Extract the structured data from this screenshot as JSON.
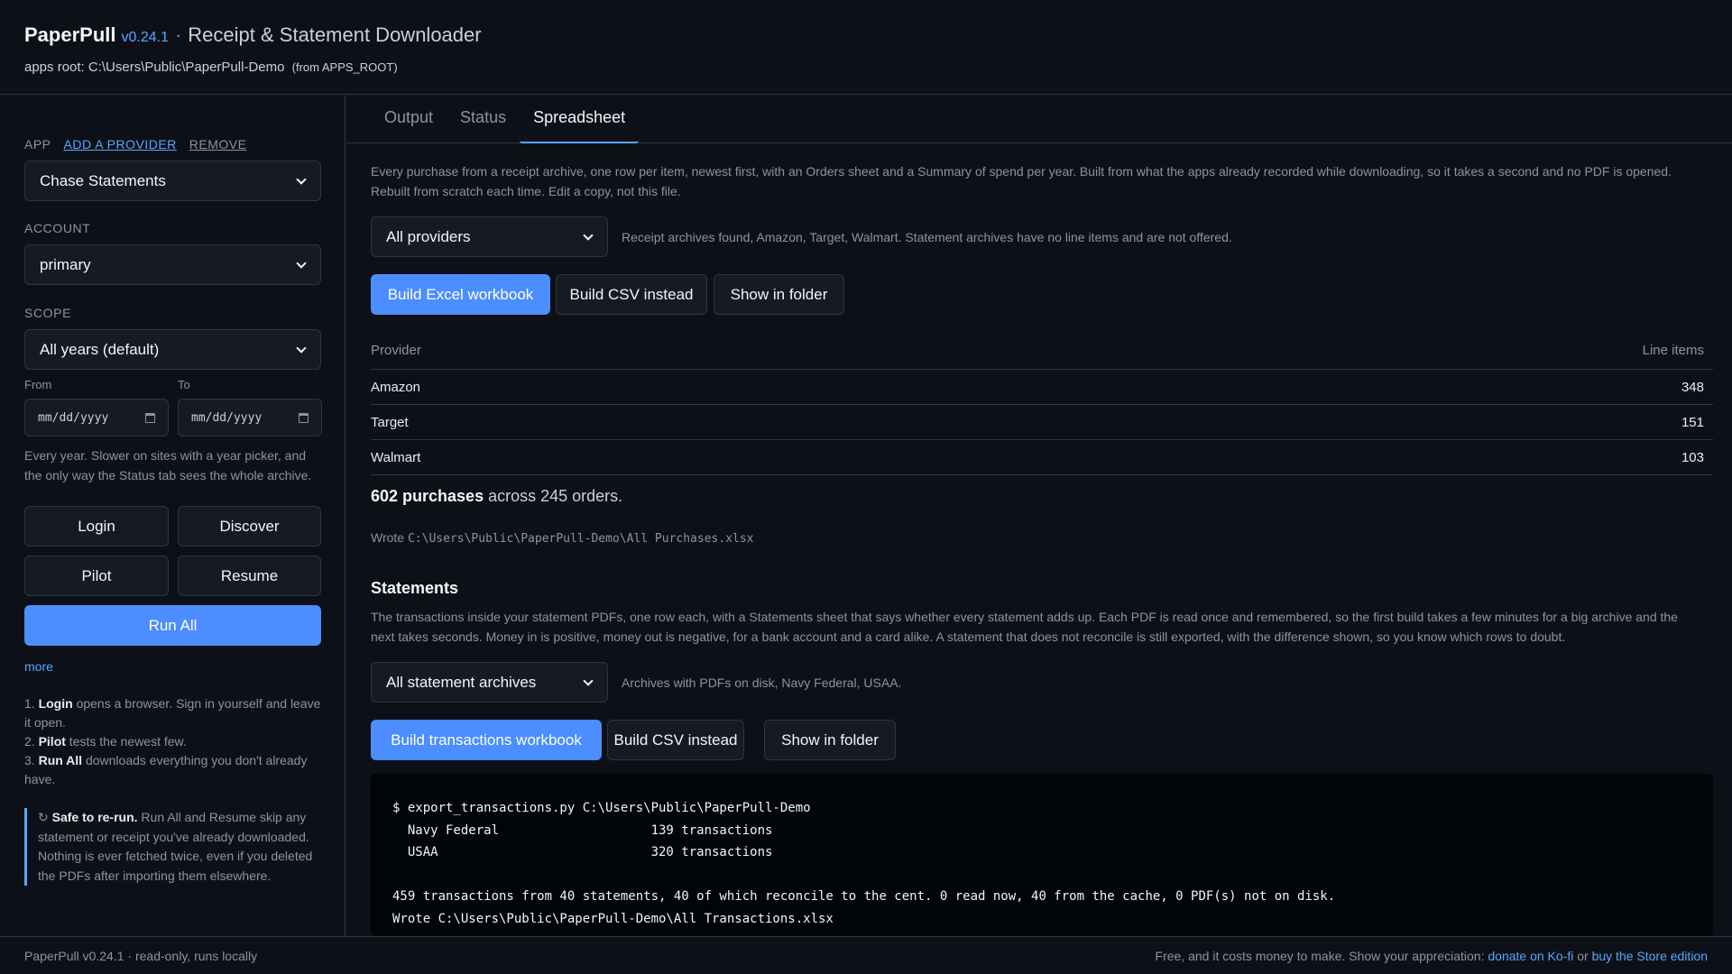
{
  "header": {
    "app_name": "PaperPull",
    "version": "v0.24.1",
    "separator": "·",
    "subtitle": "Receipt & Statement Downloader",
    "apps_root": "apps root: C:\\Users\\Public\\PaperPull-Demo",
    "apps_root_note": "(from APPS_ROOT)"
  },
  "sidebar": {
    "app_label": "APP",
    "add_provider": "ADD A PROVIDER",
    "remove": "REMOVE",
    "app_select": "Chase Statements",
    "account_label": "ACCOUNT",
    "account_select": "primary",
    "scope_label": "SCOPE",
    "scope_select": "All years (default)",
    "from_label": "From",
    "to_label": "To",
    "from_value": "mm/dd/yyyy",
    "to_value": "mm/dd/yyyy",
    "scope_hint": "Every year. Slower on sites with a year picker, and the only way the Status tab sees the whole archive.",
    "buttons": {
      "login": "Login",
      "discover": "Discover",
      "pilot": "Pilot",
      "resume": "Resume",
      "run_all": "Run All"
    },
    "more": "more",
    "steps": [
      {
        "num": "1.",
        "bold": "Login",
        "text": " opens a browser. Sign in yourself and leave it open."
      },
      {
        "num": "2.",
        "bold": "Pilot",
        "text": " tests the newest few."
      },
      {
        "num": "3.",
        "bold": "Run All",
        "text": " downloads everything you don't already have."
      }
    ],
    "safe": {
      "icon": "↻",
      "bold": "Safe to re-run.",
      "text": " Run All and Resume skip any statement or receipt you've already downloaded. Nothing is ever fetched twice, even if you deleted the PDFs after importing them elsewhere."
    }
  },
  "tabs": [
    {
      "label": "Output",
      "active": false
    },
    {
      "label": "Status",
      "active": false
    },
    {
      "label": "Spreadsheet",
      "active": true
    }
  ],
  "spreadsheet": {
    "intro": "Every purchase from a receipt archive, one row per item, newest first, with an Orders sheet and a Summary of spend per year. Built from what the apps already recorded while downloading, so it takes a second and no PDF is opened. Rebuilt from scratch each time. Edit a copy, not this file.",
    "provider_select": "All providers",
    "provider_note": "Receipt archives found, Amazon, Target, Walmart. Statement archives have no line items and are not offered.",
    "build_excel": "Build Excel workbook",
    "build_csv": "Build CSV instead",
    "show_folder": "Show in folder",
    "table": {
      "col_provider": "Provider",
      "col_items": "Line items",
      "rows": [
        {
          "provider": "Amazon",
          "items": "348"
        },
        {
          "provider": "Target",
          "items": "151"
        },
        {
          "provider": "Walmart",
          "items": "103"
        }
      ]
    },
    "summary_bold": "602 purchases",
    "summary_rest": " across 245 orders.",
    "wrote_label": "Wrote ",
    "wrote_path": "C:\\Users\\Public\\PaperPull-Demo\\All Purchases.xlsx"
  },
  "statements": {
    "title": "Statements",
    "intro": "The transactions inside your statement PDFs, one row each, with a Statements sheet that says whether every statement adds up. Each PDF is read once and remembered, so the first build takes a few minutes for a big archive and the next takes seconds. Money in is positive, money out is negative, for a bank account and a card alike. A statement that does not reconcile is still exported, with the difference shown, so you know which rows to doubt.",
    "archive_select": "All statement archives",
    "archive_note": "Archives with PDFs on disk, Navy Federal, USAA.",
    "build_transactions": "Build transactions workbook",
    "build_csv": "Build CSV instead",
    "show_folder": "Show in folder",
    "terminal": {
      "line1": "$ export_transactions.py C:\\Users\\Public\\PaperPull-Demo",
      "line2": "  Navy Federal                    139 transactions",
      "line3": "  USAA                            320 transactions",
      "line4": "",
      "line5": "459 transactions from 40 statements, 40 of which reconcile to the cent. 0 read now, 40 from the cache, 0 PDF(s) not on disk.",
      "line6": "Wrote C:\\Users\\Public\\PaperPull-Demo\\All Transactions.xlsx"
    }
  },
  "footer": {
    "left": "PaperPull v0.24.1 · read-only, runs locally",
    "right_text": "Free, and it costs money to make. Show your appreciation: ",
    "kofi": "donate on Ko-fi",
    "or": " or ",
    "store": "buy the Store edition"
  },
  "colors": {
    "background": "#0d1117",
    "accent": "#4c8dff",
    "link": "#58a6ff"
  }
}
